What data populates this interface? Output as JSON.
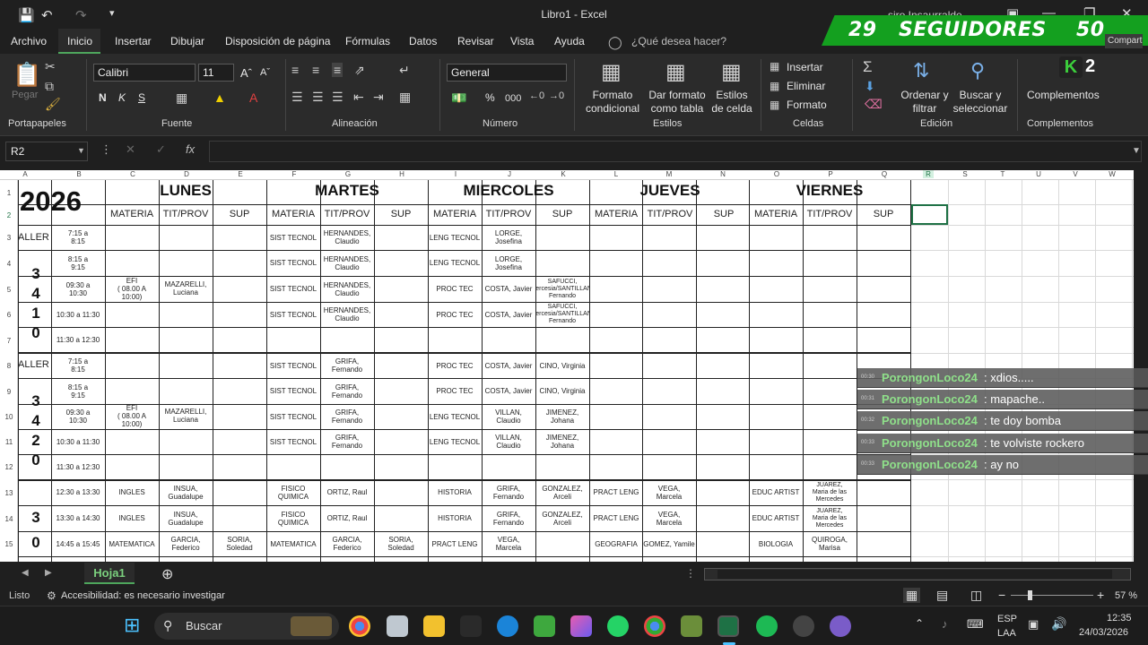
{
  "window": {
    "title": "Libro1 - Excel",
    "user": "siro Insaurralde"
  },
  "overlay": {
    "count_left": "29",
    "label": "SEGUIDORES",
    "count_right": "50",
    "badge_k": "K",
    "badge_num": "2"
  },
  "menu": [
    "Archivo",
    "Inicio",
    "Insertar",
    "Dibujar",
    "Disposición de página",
    "Fórmulas",
    "Datos",
    "Revisar",
    "Vista",
    "Ayuda"
  ],
  "menu_search": "¿Qué desea hacer?",
  "share_label": "Compartir",
  "ribbon": {
    "paste": "Pegar",
    "font_name": "Calibri",
    "font_size": "11",
    "bold": "N",
    "italic": "K",
    "underline": "S",
    "number_format": "General",
    "percent": "%",
    "thousands": "000",
    "cond_format": "Formato condicional",
    "table_format": "Dar formato como tabla",
    "cell_styles": "Estilos de celda",
    "insert": "Insertar",
    "delete": "Eliminar",
    "format": "Formato",
    "sort": "Ordenar y filtrar",
    "find": "Buscar y seleccionar",
    "addins": "Complementos",
    "groups": [
      "Portapapeles",
      "Fuente",
      "Alineación",
      "Número",
      "Estilos",
      "Celdas",
      "Edición",
      "Complementos"
    ]
  },
  "formula": {
    "cell_ref": "R2",
    "fx": "fx",
    "value": ""
  },
  "columns": [
    "A",
    "B",
    "C",
    "D",
    "E",
    "F",
    "G",
    "H",
    "I",
    "J",
    "K",
    "L",
    "M",
    "N",
    "O",
    "P",
    "Q",
    "R",
    "S",
    "T",
    "U",
    "V",
    "W"
  ],
  "rows": [
    "1",
    "2",
    "3",
    "4",
    "5",
    "6",
    "7",
    "8",
    "9",
    "10",
    "11",
    "12",
    "13",
    "14",
    "15"
  ],
  "sheet": {
    "year": "2026",
    "days": [
      "LUNES",
      "MARTES",
      "MIERCOLES",
      "JUEVES",
      "VIERNES"
    ],
    "subheaders": [
      "MATERIA",
      "TIT/PROV",
      "SUP"
    ],
    "taller": "ALLER",
    "block1_digits": [
      "3",
      "4",
      "1",
      "0"
    ],
    "block2_digits": [
      "3",
      "4",
      "2",
      "0"
    ],
    "block3_digits": [
      "3",
      "0"
    ],
    "times_a": [
      "7:15 a\n8:15",
      "8:15 a\n9:15",
      "09:30 a\n10:30",
      "10:30 a   11:30",
      "11:30 a   12:30"
    ],
    "times_c": [
      "12:30 a   13:30",
      "13:30 a   14:30",
      "14:45 a   15:45"
    ],
    "efi": "EFI\n( 08.00 A\n10:00)",
    "mazarelli": "MAZARELLI,\nLuciana",
    "sist": "SIST TECNOL",
    "hernandes": "HERNANDES,\nClaudio",
    "grifa": "GRIFA,\nFernando",
    "leng": "LENG TECNOL",
    "lorge": "LORGE,\nJosefina",
    "proc": "PROC TEC",
    "costa": "COSTA, Javier",
    "safucci": "SAFUCCI,\nNercesia/SANTILLAN,\nFernando",
    "cino": "CINO, Virginia",
    "villan": "VILLAN,\nClaudio",
    "jimenez": "JIMENEZ,\nJohana",
    "ingles": "INGLES",
    "insua": "INSUA,\nGuadalupe",
    "fisico": "FISICO\nQUIMICA",
    "ortiz": "ORTIZ, Raul",
    "historia": "HISTORIA",
    "gonzalez": "GONZALEZ,\nArceli",
    "pract": "PRACT LENG",
    "vega": "VEGA,\nMarcela",
    "educ": "EDUC ARTIST",
    "juarez": "JUAREZ,\nMaria de las\nMercedes",
    "matematica": "MATEMATICA",
    "garcia": "GARCIA,\nFederico",
    "soria": "SORIA,\nSoledad",
    "geografia": "GEOGRAFIA",
    "gomez": "GOMEZ, Yamile",
    "biologia": "BIOLOGIA",
    "quiroga": "QUIROGA,\nMarisa"
  },
  "chat": [
    {
      "time": "00:30",
      "user": "PorongonLoco24",
      "msg": ": xdios....."
    },
    {
      "time": "00:31",
      "user": "PorongonLoco24",
      "msg": ": mapache.."
    },
    {
      "time": "00:32",
      "user": "PorongonLoco24",
      "msg": ": te doy bomba"
    },
    {
      "time": "00:33",
      "user": "PorongonLoco24",
      "msg": ": te volviste rockero"
    },
    {
      "time": "00:33",
      "user": "PorongonLoco24",
      "msg": ": ay no"
    }
  ],
  "sheet_tab": "Hoja1",
  "status": {
    "ready": "Listo",
    "accessibility": "Accesibilidad: es necesario investigar",
    "zoom": "57 %"
  },
  "taskbar": {
    "search": "Buscar",
    "lang1": "ESP",
    "lang2": "LAA",
    "time": "12:35",
    "date": "24/03/2026"
  },
  "colors": {
    "excel_green": "#1e7145",
    "overlay_green": "#14a01f",
    "chat_user": "#8fe08a"
  }
}
